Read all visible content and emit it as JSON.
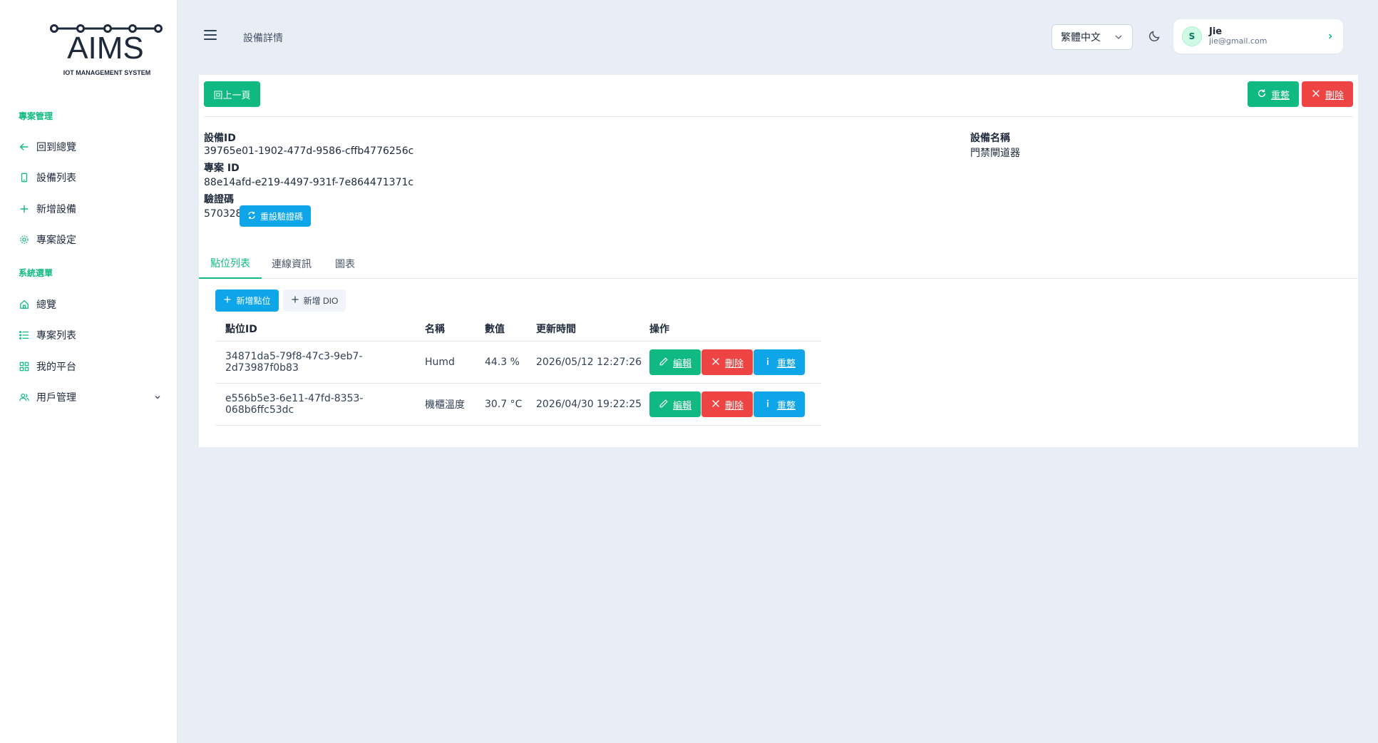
{
  "brand": {
    "logo_text": "AIMS",
    "logo_subtitle": "IOT MANAGEMENT SYSTEM"
  },
  "sidebar": {
    "sections": [
      {
        "title": "專案管理",
        "items": [
          {
            "label": "回到總覽",
            "icon": "arrow-left-icon"
          },
          {
            "label": "設備列表",
            "icon": "device-icon"
          },
          {
            "label": "新增設備",
            "icon": "plus-icon"
          },
          {
            "label": "專案設定",
            "icon": "gear-icon"
          }
        ]
      },
      {
        "title": "系統選單",
        "items": [
          {
            "label": "總覽",
            "icon": "home-icon"
          },
          {
            "label": "專案列表",
            "icon": "list-icon"
          },
          {
            "label": "我的平台",
            "icon": "grid-icon"
          },
          {
            "label": "用戶管理",
            "icon": "users-icon"
          }
        ]
      }
    ]
  },
  "header": {
    "title": "設備詳情",
    "language": "繁體中文",
    "user": {
      "initial": "S",
      "name": "Jie",
      "email": "jie@gmail.com"
    }
  },
  "toolbar": {
    "back_label": "回上一頁",
    "restart_label": "重整",
    "delete_label": "刪除"
  },
  "device": {
    "id_label": "設備ID",
    "id_value": "39765e01-1902-477d-9586-cffb4776256c",
    "project_label": "專案 ID",
    "project_value": "88e14afd-e219-4497-931f-7e864471371c",
    "code_label": "驗證碼",
    "code_value": "570328",
    "reset_code_label": "重設驗證碼",
    "name_label": "設備名稱",
    "name_value": "門禁閘道器"
  },
  "tabs": [
    {
      "label": "點位列表",
      "active": true
    },
    {
      "label": "連線資訊",
      "active": false
    },
    {
      "label": "圖表",
      "active": false
    }
  ],
  "points": {
    "add_point_label": "新增點位",
    "add_dio_label": "新增 DIO",
    "columns": [
      "點位ID",
      "名稱",
      "數值",
      "更新時間",
      "操作"
    ],
    "rows": [
      {
        "id": "34871da5-79f8-47c3-9eb7-2d73987f0b83",
        "name": "Humd",
        "value": "44.3 %",
        "updated": "2026/05/12 12:27:26"
      },
      {
        "id": "e556b5e3-6e11-47fd-8353-068b6ffc53dc",
        "name": "機櫃溫度",
        "value": "30.7 °C",
        "updated": "2026/04/30 19:22:25"
      }
    ],
    "actions": {
      "edit": "編輯",
      "delete": "刪除",
      "reset": "重整"
    }
  },
  "colors": {
    "accent": "#10b981",
    "danger": "#ef4444",
    "info": "#0ea5e9",
    "background": "#e9edf5"
  }
}
